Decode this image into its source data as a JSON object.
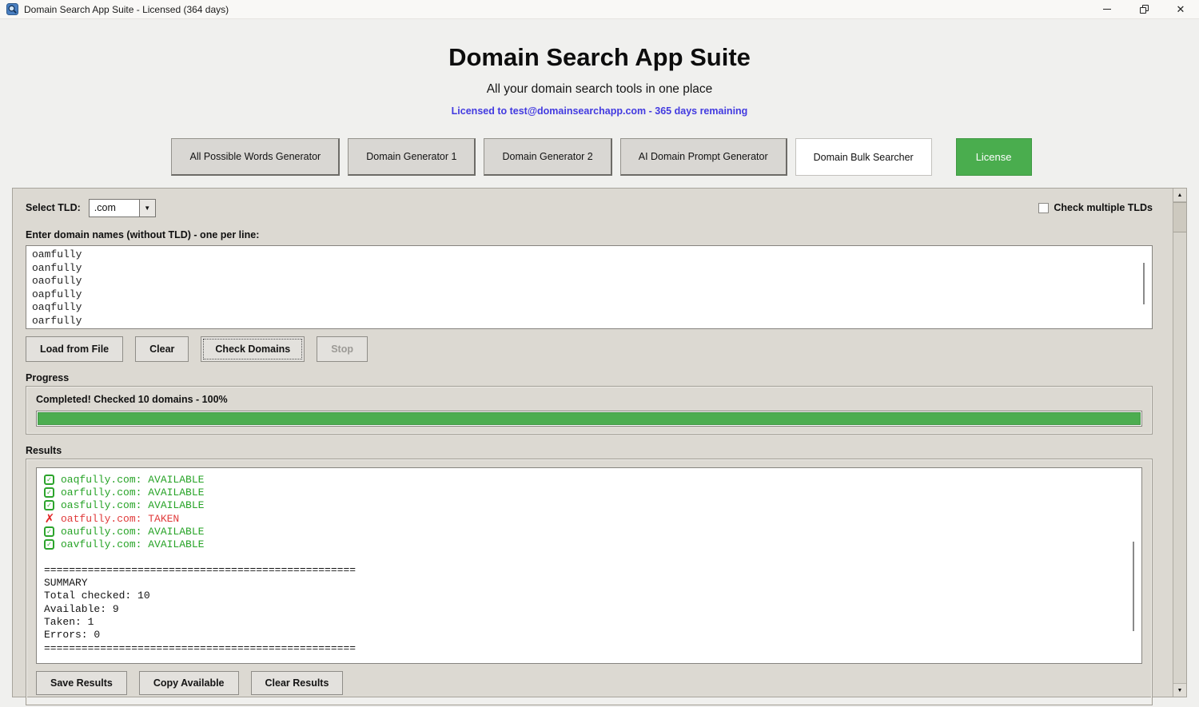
{
  "window": {
    "title": "Domain Search App Suite - Licensed (364 days)"
  },
  "header": {
    "title": "Domain Search App Suite",
    "subtitle": "All your domain search tools in one place",
    "license_line": "Licensed to test@domainsearchapp.com - 365 days remaining"
  },
  "tabs": [
    {
      "name": "all-possible-words-generator",
      "label": "All Possible Words Generator",
      "active": false
    },
    {
      "name": "domain-generator-1",
      "label": "Domain Generator 1",
      "active": false
    },
    {
      "name": "domain-generator-2",
      "label": "Domain Generator 2",
      "active": false
    },
    {
      "name": "ai-domain-prompt-generator",
      "label": "AI Domain Prompt Generator",
      "active": false
    },
    {
      "name": "domain-bulk-searcher",
      "label": "Domain Bulk Searcher",
      "active": true
    }
  ],
  "license_button_label": "License",
  "panel": {
    "tld_label": "Select TLD:",
    "tld_value": ".com",
    "multi_tld_label": "Check multiple TLDs",
    "multi_tld_checked": false,
    "domains_label": "Enter domain names (without TLD) - one per line:",
    "domains_text": "oamfully\noanfully\noaofully\noapfully\noaqfully\noarfully",
    "action_buttons": {
      "load": "Load from File",
      "clear": "Clear",
      "check": "Check Domains",
      "stop": "Stop"
    },
    "progress": {
      "group_label": "Progress",
      "status_text": "Completed! Checked 10 domains - 100%",
      "percent": 100
    },
    "results": {
      "group_label": "Results",
      "items": [
        {
          "domain": "oaqfully.com",
          "status": "AVAILABLE"
        },
        {
          "domain": "oarfully.com",
          "status": "AVAILABLE"
        },
        {
          "domain": "oasfully.com",
          "status": "AVAILABLE"
        },
        {
          "domain": "oatfully.com",
          "status": "TAKEN"
        },
        {
          "domain": "oaufully.com",
          "status": "AVAILABLE"
        },
        {
          "domain": "oavfully.com",
          "status": "AVAILABLE"
        }
      ],
      "summary_lines": [
        "==================================================",
        "SUMMARY",
        "Total checked: 10",
        "Available: 9",
        "Taken: 1",
        "Errors: 0",
        "=================================================="
      ],
      "buttons": {
        "save": "Save Results",
        "copy": "Copy Available",
        "clear": "Clear Results"
      }
    }
  },
  "colors": {
    "license_green": "#4aad4e",
    "progress_green": "#4cad50",
    "link_blue": "#423ae0",
    "available_green": "#27a327",
    "taken_red": "#e03a3a"
  }
}
